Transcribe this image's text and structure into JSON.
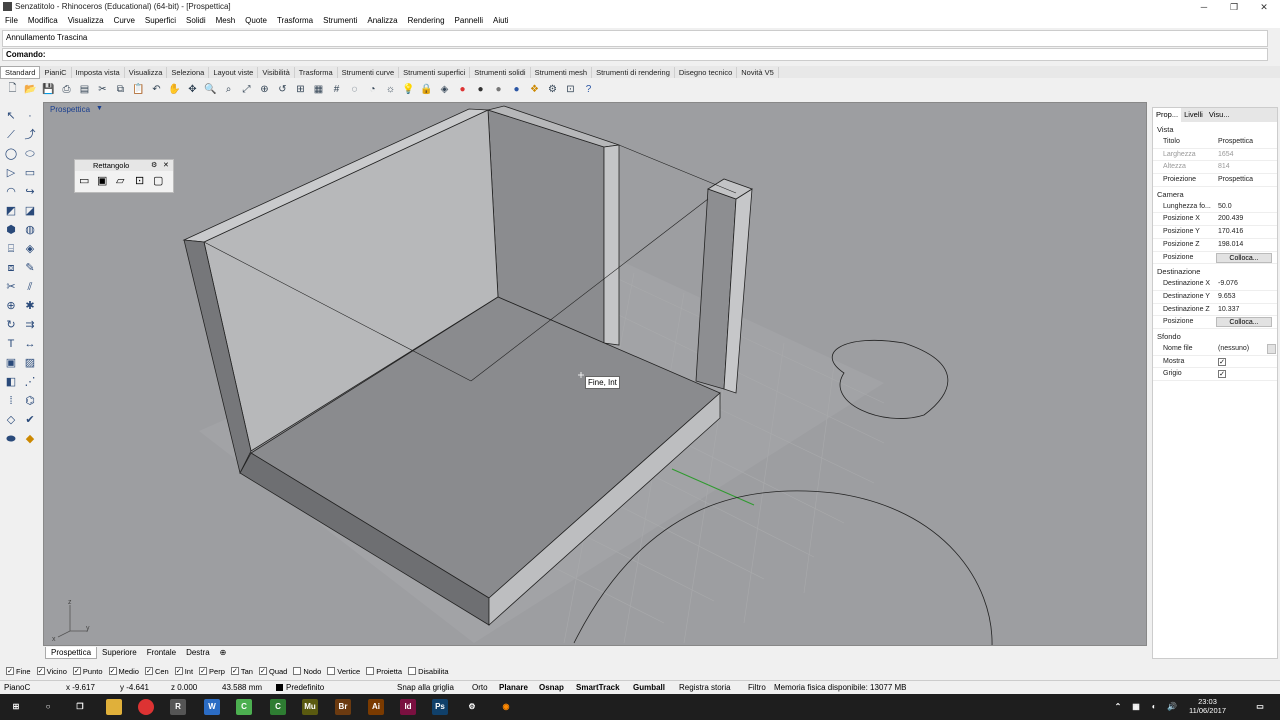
{
  "window": {
    "title": "Senzatitolo - Rhinoceros (Educational) (64-bit) - [Prospettica]"
  },
  "menu": [
    "File",
    "Modifica",
    "Visualizza",
    "Curve",
    "Superfici",
    "Solidi",
    "Mesh",
    "Quote",
    "Trasforma",
    "Strumenti",
    "Analizza",
    "Rendering",
    "Pannelli",
    "Aiuti"
  ],
  "command": {
    "history": "Annullamento Trascina",
    "prompt": "Comando:"
  },
  "toolbar_tabs": [
    "Standard",
    "PianiC",
    "Imposta vista",
    "Visualizza",
    "Seleziona",
    "Layout viste",
    "Visibilità",
    "Trasforma",
    "Strumenti curve",
    "Strumenti superfici",
    "Strumenti solidi",
    "Strumenti mesh",
    "Strumenti di rendering",
    "Disegno tecnico",
    "Novità V5"
  ],
  "viewport": {
    "title": "Prospettica",
    "tooltip": "Fine, Int",
    "axis_z": "z",
    "axis_x": "x",
    "axis_y": "y"
  },
  "floating_toolbar": {
    "title": "Rettangolo"
  },
  "viewport_tabs": [
    "Prospettica",
    "Superiore",
    "Frontale",
    "Destra"
  ],
  "osnaps": [
    {
      "label": "Fine",
      "checked": true
    },
    {
      "label": "Vicino",
      "checked": true
    },
    {
      "label": "Punto",
      "checked": true
    },
    {
      "label": "Medio",
      "checked": true
    },
    {
      "label": "Cen",
      "checked": true
    },
    {
      "label": "Int",
      "checked": true
    },
    {
      "label": "Perp",
      "checked": true
    },
    {
      "label": "Tan",
      "checked": true
    },
    {
      "label": "Quad",
      "checked": true
    },
    {
      "label": "Nodo",
      "checked": false
    },
    {
      "label": "Vertice",
      "checked": false
    },
    {
      "label": "Proietta",
      "checked": false
    },
    {
      "label": "Disabilita",
      "checked": false
    }
  ],
  "status": {
    "cplane": "PianoC",
    "x": "x -9.617",
    "y": "y -4.641",
    "z": "z 0.000",
    "dist": "43.588 mm",
    "layer": "Predefinito",
    "grid_snap": "Snap alla griglia",
    "ortho": "Orto",
    "planar": "Planare",
    "osnap": "Osnap",
    "smarttrack": "SmartTrack",
    "gumball": "Gumball",
    "history": "Registra storia",
    "filter": "Filtro",
    "memory": "Memoria fisica disponibile: 13077 MB"
  },
  "panel": {
    "tabs": [
      "Prop...",
      "Livelli",
      "Visu..."
    ],
    "view_section": "Vista",
    "view_rows": [
      {
        "k": "Titolo",
        "v": "Prospettica",
        "dim": false
      },
      {
        "k": "Larghezza",
        "v": "1654",
        "dim": true
      },
      {
        "k": "Altezza",
        "v": "814",
        "dim": true
      },
      {
        "k": "Proiezione",
        "v": "Prospettica",
        "dim": false
      }
    ],
    "camera_section": "Camera",
    "camera_rows": [
      {
        "k": "Lunghezza fo...",
        "v": "50.0"
      },
      {
        "k": "Posizione X",
        "v": "200.439"
      },
      {
        "k": "Posizione Y",
        "v": "170.416"
      },
      {
        "k": "Posizione Z",
        "v": "198.014"
      }
    ],
    "camera_pos_label": "Posizione",
    "place_button": "Colloca...",
    "target_section": "Destinazione",
    "target_rows": [
      {
        "k": "Destinazione X",
        "v": "-9.076"
      },
      {
        "k": "Destinazione Y",
        "v": "9.653"
      },
      {
        "k": "Destinazione Z",
        "v": "10.337"
      }
    ],
    "target_pos_label": "Posizione",
    "bg_section": "Sfondo",
    "bg_file_label": "Nome file",
    "bg_file_value": "(nessuno)",
    "bg_show": "Mostra",
    "bg_gray": "Grigio"
  },
  "clock": {
    "time": "23:03",
    "date": "11/06/2017"
  },
  "colors": {
    "viewport_bg": "#9d9ea1",
    "accent": "#1a3f8f"
  }
}
